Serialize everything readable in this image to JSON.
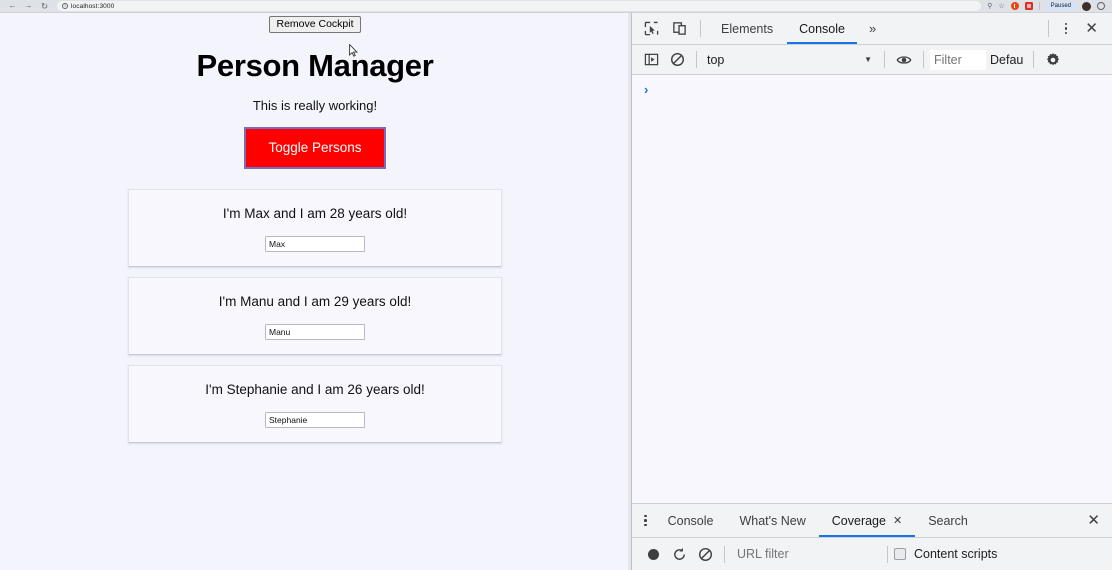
{
  "browser": {
    "back_icon": "back-arrow-icon",
    "forward_icon": "forward-arrow-icon",
    "reload_icon": "reload-icon",
    "url": "localhost:3000",
    "search_icon": "search-icon",
    "bookmark_icon": "star-icon",
    "extension_1": "extension-icon-orange",
    "extension_2": "extension-icon-red",
    "paused_badge": "Paused",
    "profile_icon": "avatar-icon",
    "menu_icon": "chrome-menu-icon"
  },
  "page": {
    "cockpit_button": "Remove Cockpit",
    "title": "Person Manager",
    "subtitle": "This is really working!",
    "toggle_button": "Toggle Persons",
    "accent_red": "#fe0000",
    "background": "#f4f4fc",
    "persons": [
      {
        "text": "I'm Max and I am 28 years old!",
        "input_value": "Max"
      },
      {
        "text": "I'm Manu and I am 29 years old!",
        "input_value": "Manu"
      },
      {
        "text": "I'm Stephanie and I am 26 years old!",
        "input_value": "Stephanie"
      }
    ]
  },
  "devtools": {
    "inspect_icon": "inspect-element-icon",
    "device_icon": "device-toolbar-icon",
    "tabs": [
      {
        "label": "Elements",
        "active": false
      },
      {
        "label": "Console",
        "active": true
      }
    ],
    "more_tabs_icon": "chevrons-right-icon",
    "settings_menu_icon": "kebab-menu-icon",
    "close_icon": "close-icon",
    "console_toolbar": {
      "sidebar_icon": "console-sidebar-icon",
      "clear_icon": "clear-console-icon",
      "context": "top",
      "context_caret": "chevron-down-icon",
      "eye_icon": "live-expression-eye-icon",
      "filter_placeholder": "Filter",
      "levels": "Defau",
      "gear_icon": "settings-gear-icon"
    },
    "console_prompt": "›",
    "drawer": {
      "menu_icon": "kebab-menu-icon",
      "tabs": [
        {
          "label": "Console",
          "active": false,
          "closable": false
        },
        {
          "label": "What's New",
          "active": false,
          "closable": false
        },
        {
          "label": "Coverage",
          "active": true,
          "closable": true
        },
        {
          "label": "Search",
          "active": false,
          "closable": false
        }
      ],
      "close_icon": "close-icon",
      "coverage_toolbar": {
        "record_icon": "record-icon",
        "reload_icon": "reload-icon",
        "clear_icon": "clear-icon",
        "url_filter_placeholder": "URL filter",
        "content_scripts_label": "Content scripts"
      }
    },
    "accent_blue": "#1a73e8"
  }
}
